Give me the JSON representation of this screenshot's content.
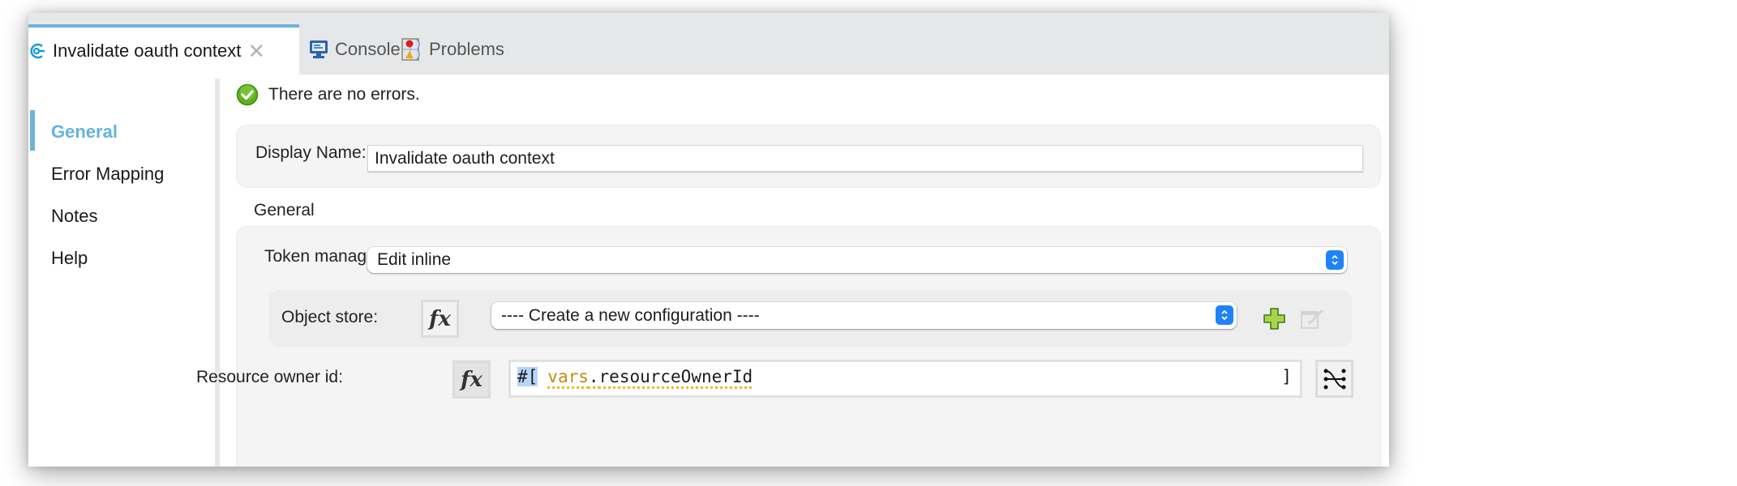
{
  "tabs": [
    {
      "label": "Invalidate oauth context",
      "icon": "flow-component-icon",
      "active": true,
      "closable": true
    },
    {
      "label": "Console",
      "icon": "console-monitor-icon",
      "active": false
    },
    {
      "label": "Problems",
      "icon": "problems-icon",
      "active": false
    }
  ],
  "sidebar": {
    "items": [
      {
        "label": "General",
        "active": true
      },
      {
        "label": "Error Mapping",
        "active": false
      },
      {
        "label": "Notes",
        "active": false
      },
      {
        "label": "Help",
        "active": false
      }
    ]
  },
  "status": {
    "icon": "success-check-icon",
    "message": "There are no errors."
  },
  "display_name": {
    "label": "Display Name:",
    "value": "Invalidate oauth context"
  },
  "general_section": {
    "title": "General",
    "token_manager": {
      "label": "Token manager",
      "selected": "Edit inline"
    },
    "object_store": {
      "label": "Object store:",
      "fx_label": "fx",
      "selected": "---- Create a new configuration ----",
      "add_icon": "add-plus-icon",
      "edit_icon": "edit-config-icon"
    },
    "resource_owner_id": {
      "label": "Resource owner id:",
      "fx_label": "fx",
      "expr_open": "#[",
      "expr_var": "vars",
      "expr_dot": ".",
      "expr_prop": "resourceOwnerId",
      "expr_close": "]",
      "mapping_icon": "data-mapping-icon"
    }
  },
  "colors": {
    "accent": "#6cb4dc",
    "stepper_blue": "#1f82f7",
    "success_green": "#5cb31c",
    "add_green": "#8cc43c",
    "var_color": "#c98a0f"
  }
}
